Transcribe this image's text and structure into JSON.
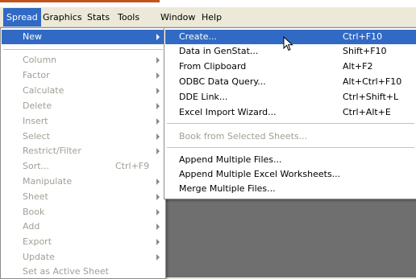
{
  "menubar": {
    "items": [
      "Spread",
      "Graphics",
      "Stats",
      "Tools",
      "Window",
      "Help"
    ]
  },
  "spread_menu": {
    "items": [
      {
        "label": "New",
        "shortcut": "",
        "submenu": true,
        "state": "highlighted"
      },
      {
        "label": "Column",
        "shortcut": "",
        "submenu": true,
        "state": "disabled"
      },
      {
        "label": "Factor",
        "shortcut": "",
        "submenu": true,
        "state": "disabled"
      },
      {
        "label": "Calculate",
        "shortcut": "",
        "submenu": true,
        "state": "disabled"
      },
      {
        "label": "Delete",
        "shortcut": "",
        "submenu": true,
        "state": "disabled"
      },
      {
        "label": "Insert",
        "shortcut": "",
        "submenu": true,
        "state": "disabled"
      },
      {
        "label": "Select",
        "shortcut": "",
        "submenu": true,
        "state": "disabled"
      },
      {
        "label": "Restrict/Filter",
        "shortcut": "",
        "submenu": true,
        "state": "disabled"
      },
      {
        "label": "Sort...",
        "shortcut": "Ctrl+F9",
        "submenu": false,
        "state": "disabled"
      },
      {
        "label": "Manipulate",
        "shortcut": "",
        "submenu": true,
        "state": "disabled"
      },
      {
        "label": "Sheet",
        "shortcut": "",
        "submenu": true,
        "state": "disabled"
      },
      {
        "label": "Book",
        "shortcut": "",
        "submenu": true,
        "state": "disabled"
      },
      {
        "label": "Add",
        "shortcut": "",
        "submenu": true,
        "state": "disabled"
      },
      {
        "label": "Export",
        "shortcut": "",
        "submenu": true,
        "state": "disabled"
      },
      {
        "label": "Update",
        "shortcut": "",
        "submenu": true,
        "state": "disabled"
      },
      {
        "label": "Set as Active Sheet",
        "shortcut": "",
        "submenu": false,
        "state": "disabled"
      }
    ]
  },
  "new_submenu": {
    "items": [
      {
        "label": "Create...",
        "shortcut": "Ctrl+F10",
        "state": "highlighted"
      },
      {
        "label": "Data in GenStat...",
        "shortcut": "Shift+F10",
        "state": "enabled"
      },
      {
        "label": "From Clipboard",
        "shortcut": "Alt+F2",
        "state": "enabled"
      },
      {
        "label": "ODBC Data Query...",
        "shortcut": "Alt+Ctrl+F10",
        "state": "enabled"
      },
      {
        "label": "DDE Link...",
        "shortcut": "Ctrl+Shift+L",
        "state": "enabled"
      },
      {
        "label": "Excel Import Wizard...",
        "shortcut": "Ctrl+Alt+E",
        "state": "enabled"
      },
      {
        "label": "Book from Selected Sheets...",
        "shortcut": "",
        "state": "disabled"
      },
      {
        "label": "Append Multiple Files...",
        "shortcut": "",
        "state": "enabled"
      },
      {
        "label": "Append Multiple Excel Worksheets...",
        "shortcut": "",
        "state": "enabled"
      },
      {
        "label": "Merge Multiple Files...",
        "shortcut": "",
        "state": "enabled"
      }
    ]
  },
  "colors": {
    "menu_highlight": "#316ac5",
    "disabled_text": "#a19e94",
    "title_accent": "#c1541f",
    "workspace": "#6f6f6f"
  },
  "icons": {
    "cursor": "mouse-pointer-icon",
    "submenu_arrow": "chevron-right-icon"
  }
}
